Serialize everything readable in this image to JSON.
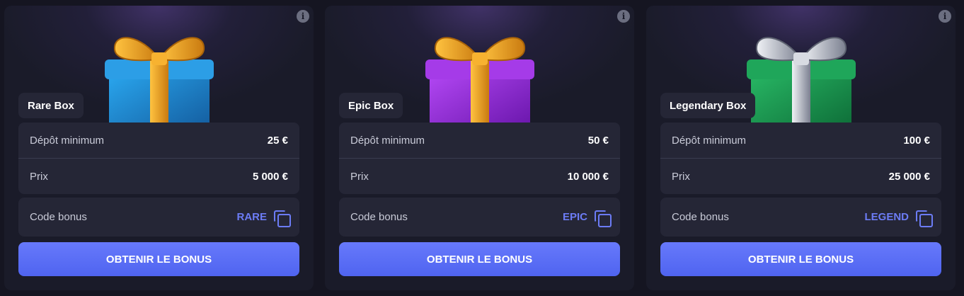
{
  "cards": [
    {
      "name": "Rare Box",
      "deposit_label": "Dépôt minimum",
      "deposit_value": "25 €",
      "price_label": "Prix",
      "price_value": "5 000 €",
      "code_label": "Code bonus",
      "code_value": "RARE",
      "button_label": "OBTENIR LE BONUS",
      "box_color": "#1f8fd8",
      "ribbon_color": "#f0a020"
    },
    {
      "name": "Epic Box",
      "deposit_label": "Dépôt minimum",
      "deposit_value": "50 €",
      "price_label": "Prix",
      "price_value": "10 000 €",
      "code_label": "Code bonus",
      "code_value": "EPIC",
      "button_label": "OBTENIR LE BONUS",
      "box_color": "#9a2ee0",
      "ribbon_color": "#f0a020"
    },
    {
      "name": "Legendary Box",
      "deposit_label": "Dépôt minimum",
      "deposit_value": "100 €",
      "price_label": "Prix",
      "price_value": "25 000 €",
      "code_label": "Code bonus",
      "code_value": "LEGEND",
      "button_label": "OBTENIR LE BONUS",
      "box_color": "#1a9a52",
      "ribbon_color": "#c8ccd4"
    }
  ],
  "info_icon": "info-icon",
  "copy_icon": "copy-icon",
  "colors": {
    "background": "#151521",
    "card": "#1a1b29",
    "panel": "#252636",
    "accent": "#6c7cf5"
  }
}
